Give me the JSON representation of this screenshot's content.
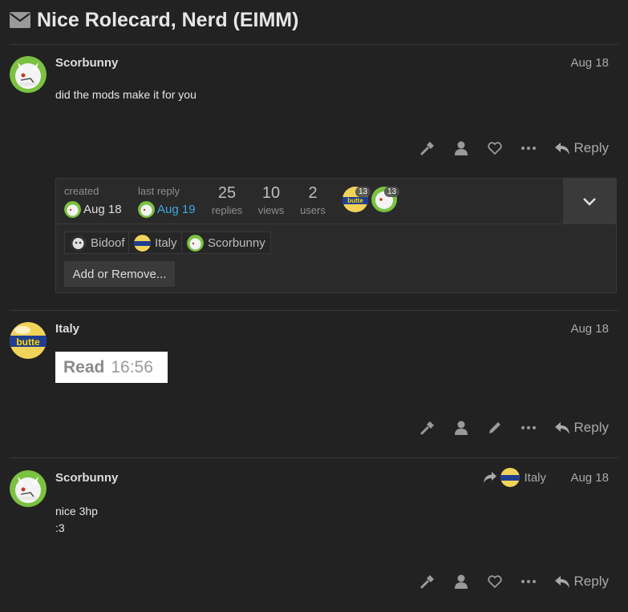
{
  "topic": {
    "title": "Nice Rolecard, Nerd (EIMM)"
  },
  "icons": {
    "title": "envelope-icon",
    "admin": "wrench-icon",
    "user": "user-icon",
    "like": "heart-icon",
    "edit": "pencil-icon",
    "more": "ellipsis-icon",
    "reply": "reply-icon",
    "expand": "chevron-down-icon",
    "reply_to": "share-arrow-icon"
  },
  "posts": [
    {
      "username": "Scorbunny",
      "date": "Aug 18",
      "lines": [
        "did the mods make it for you"
      ],
      "reply_label": "Reply"
    },
    {
      "username": "Italy",
      "date": "Aug 18",
      "image_text": {
        "word": "Read",
        "time": "16:56"
      },
      "reply_label": "Reply"
    },
    {
      "username": "Scorbunny",
      "date": "Aug 18",
      "reply_to": "Italy",
      "lines": [
        "nice 3hp",
        ":3"
      ],
      "reply_label": "Reply"
    }
  ],
  "topic_map": {
    "created_label": "created",
    "created_date": "Aug 18",
    "last_reply_label": "last reply",
    "last_reply_date": "Aug 19",
    "stats": [
      {
        "value": "25",
        "label": "replies"
      },
      {
        "value": "10",
        "label": "views"
      },
      {
        "value": "2",
        "label": "users"
      }
    ],
    "participant_counts": [
      "13",
      "13"
    ],
    "participants": [
      "Bidoof",
      "Italy",
      "Scorbunny"
    ],
    "add_remove_label": "Add or Remove..."
  },
  "colors": {
    "background": "#222222",
    "link": "#3ea7e0",
    "avatar_green": "#7bc142"
  }
}
